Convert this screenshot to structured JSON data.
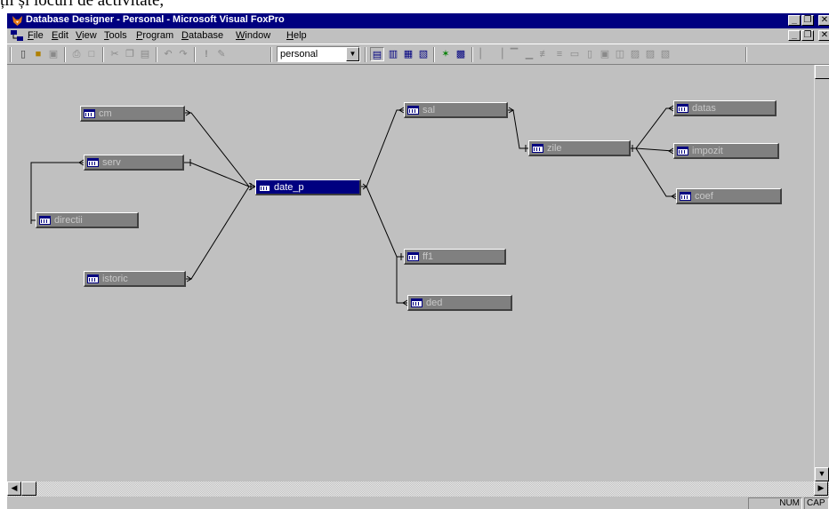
{
  "document": {
    "cut_text": "ții și locuri de activitate,"
  },
  "window": {
    "title": "Database Designer - Personal - Microsoft Visual FoxPro"
  },
  "menu": {
    "items": [
      {
        "label": "File",
        "key": "F"
      },
      {
        "label": "Edit",
        "key": "E"
      },
      {
        "label": "View",
        "key": "V"
      },
      {
        "label": "Tools",
        "key": "T"
      },
      {
        "label": "Program",
        "key": "P"
      },
      {
        "label": "Database",
        "key": "D"
      },
      {
        "label": "Window",
        "key": "W"
      },
      {
        "label": "Help",
        "key": "H"
      }
    ]
  },
  "toolbar": {
    "database_combo": "personal",
    "icons": [
      "new-icon",
      "open-icon",
      "save-icon",
      "print-icon",
      "print-preview-icon",
      "cut-icon",
      "copy-icon",
      "paste-icon",
      "undo-icon",
      "redo-icon",
      "run-icon",
      "modify-form-icon",
      "command-window-icon",
      "view-window-icon",
      "form-wizard-icon",
      "report-wizard-icon",
      "auto-wizard-icon",
      "data-session-icon",
      "layout-icon"
    ]
  },
  "tables": [
    {
      "name": "cm",
      "selected": false
    },
    {
      "name": "serv",
      "selected": false
    },
    {
      "name": "directii",
      "selected": false
    },
    {
      "name": "istoric",
      "selected": false
    },
    {
      "name": "date_p",
      "selected": true
    },
    {
      "name": "sal",
      "selected": false
    },
    {
      "name": "zile",
      "selected": false
    },
    {
      "name": "ff1",
      "selected": false
    },
    {
      "name": "ded",
      "selected": false
    },
    {
      "name": "datas",
      "selected": false
    },
    {
      "name": "impozit",
      "selected": false
    },
    {
      "name": "coef",
      "selected": false
    }
  ],
  "relations": [
    {
      "from": "cm",
      "to": "date_p"
    },
    {
      "from": "serv",
      "to": "date_p"
    },
    {
      "from": "istoric",
      "to": "date_p"
    },
    {
      "from": "serv",
      "to": "directii"
    },
    {
      "from": "date_p",
      "to": "sal"
    },
    {
      "from": "date_p",
      "to": "ff1"
    },
    {
      "from": "date_p",
      "to": "ded"
    },
    {
      "from": "sal",
      "to": "zile"
    },
    {
      "from": "zile",
      "to": "datas"
    },
    {
      "from": "zile",
      "to": "impozit"
    },
    {
      "from": "zile",
      "to": "coef"
    }
  ],
  "status": {
    "num": "NUM",
    "caps": "CAP"
  },
  "colors": {
    "titlebar": "#000080",
    "face": "#c0c0c0",
    "table_bar": "#808080",
    "selected_table": "#000080"
  }
}
